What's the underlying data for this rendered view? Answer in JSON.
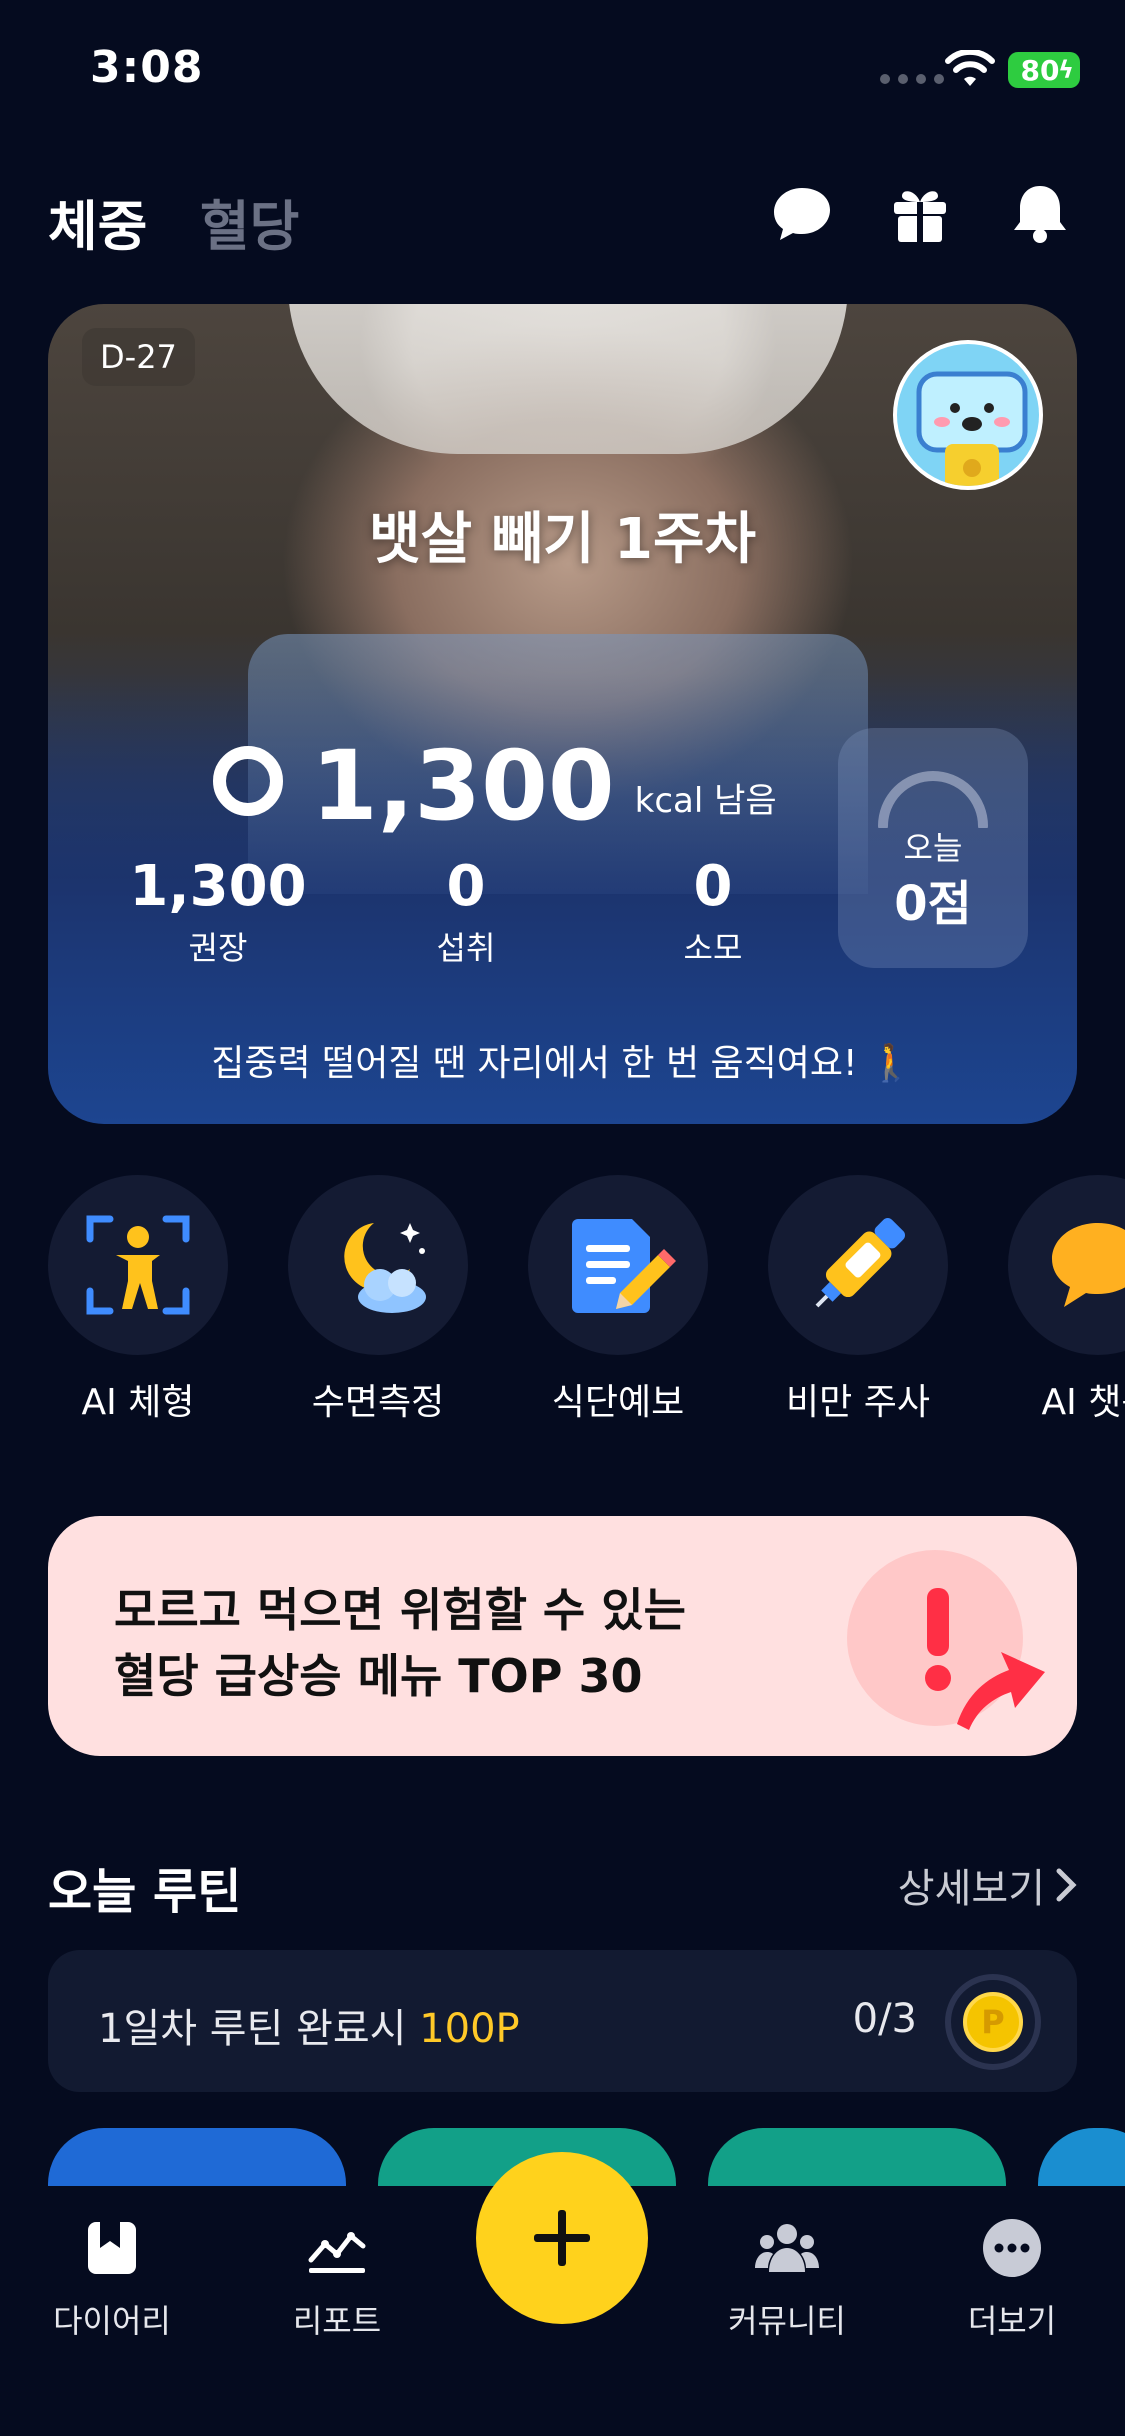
{
  "status_bar": {
    "time": "3:08",
    "battery": "80"
  },
  "header": {
    "tabs": [
      {
        "label": "체중",
        "active": true
      },
      {
        "label": "혈당",
        "active": false
      }
    ],
    "icons": [
      "chat-icon",
      "gift-icon",
      "bell-icon"
    ]
  },
  "hero": {
    "dday": "D-27",
    "title": "뱃살 빼기 1주차",
    "kcal_value": "1,300",
    "kcal_unit": "kcal 남음",
    "stats": [
      {
        "value": "1,300",
        "label": "권장"
      },
      {
        "value": "0",
        "label": "섭취"
      },
      {
        "value": "0",
        "label": "소모"
      }
    ],
    "score_label": "오늘",
    "score_value": "0점",
    "tip": "집중력 떨어질 땐 자리에서 한 번 움직여요! 🚶"
  },
  "shortcuts": [
    {
      "label": "AI 체형",
      "icon": "body-scan-icon"
    },
    {
      "label": "수면측정",
      "icon": "moon-cloud-icon"
    },
    {
      "label": "식단예보",
      "icon": "memo-pencil-icon"
    },
    {
      "label": "비만 주사",
      "icon": "injection-pen-icon"
    },
    {
      "label": "AI 챗봇",
      "icon": "speech-bubble-icon"
    }
  ],
  "banner": {
    "line1": "모르고 먹으면 위험할 수 있는",
    "line2": "혈당 급상승 메뉴 TOP 30"
  },
  "routine": {
    "title": "오늘 루틴",
    "more": "상세보기",
    "text": "1일차 루틴 완료시 ",
    "points": "100P",
    "count": "0/3",
    "coin": "P"
  },
  "bottom_nav": [
    {
      "label": "다이어리",
      "icon": "diary-icon"
    },
    {
      "label": "리포트",
      "icon": "chart-icon"
    },
    {
      "label": "커뮤니티",
      "icon": "community-icon"
    },
    {
      "label": "더보기",
      "icon": "more-icon"
    }
  ],
  "colors": {
    "background": "#050b1f",
    "accent_yellow": "#ffd21c",
    "banner_bg": "#ffe0e0",
    "card_bg": "#121a31"
  }
}
